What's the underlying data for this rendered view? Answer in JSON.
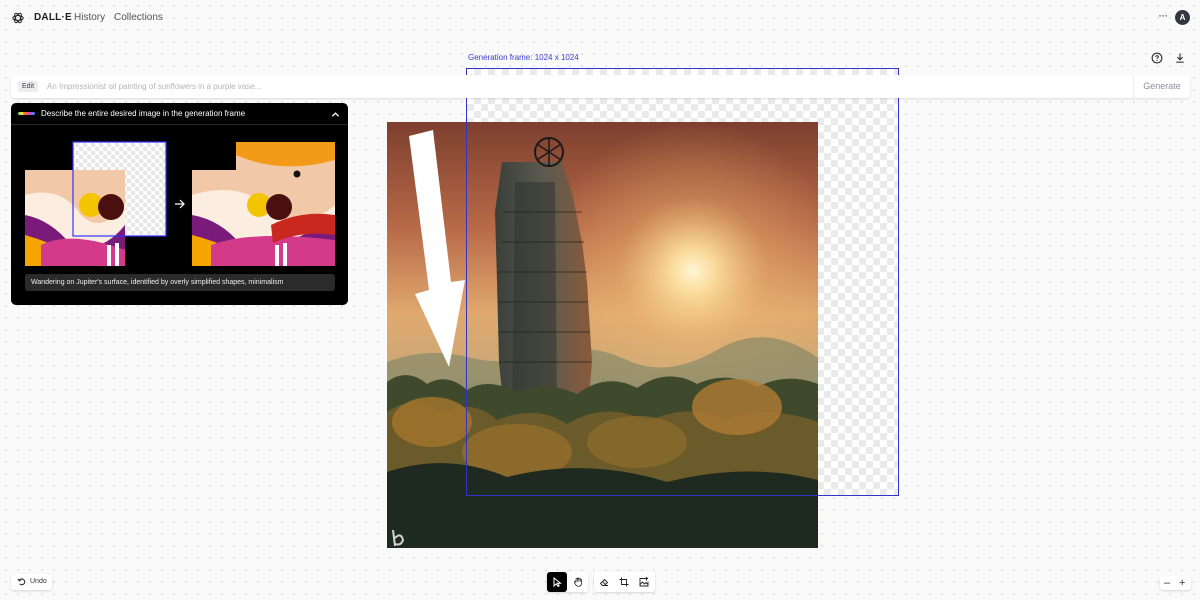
{
  "nav": {
    "brand": "DALL·E",
    "history": "History",
    "collections": "Collections",
    "avatar_initial": "A",
    "more": "···"
  },
  "prompt": {
    "edit_badge": "Edit",
    "placeholder": "An Impressionist oil painting of sunflowers in a purple vase...",
    "value": "",
    "generate_label": "Generate"
  },
  "canvas": {
    "generation_frame_label": "Generation frame: 1024 x 1024"
  },
  "tip": {
    "title": "Describe the entire desired image in the generation frame",
    "example_caption": "Wandering on Jupiter's surface, identified by overly simplified shapes, minimalism"
  },
  "toolbar": {
    "undo_label": "Undo",
    "tools": [
      "select-tool",
      "pan-tool",
      "eraser-tool",
      "add-generation-frame-tool",
      "upload-image-tool"
    ],
    "active_tool": "select-tool"
  },
  "zoom": {
    "out": "–",
    "in": "+"
  },
  "colors": {
    "accent": "#3333cc",
    "brand_dark": "#202123",
    "panel_bg": "#000000"
  }
}
